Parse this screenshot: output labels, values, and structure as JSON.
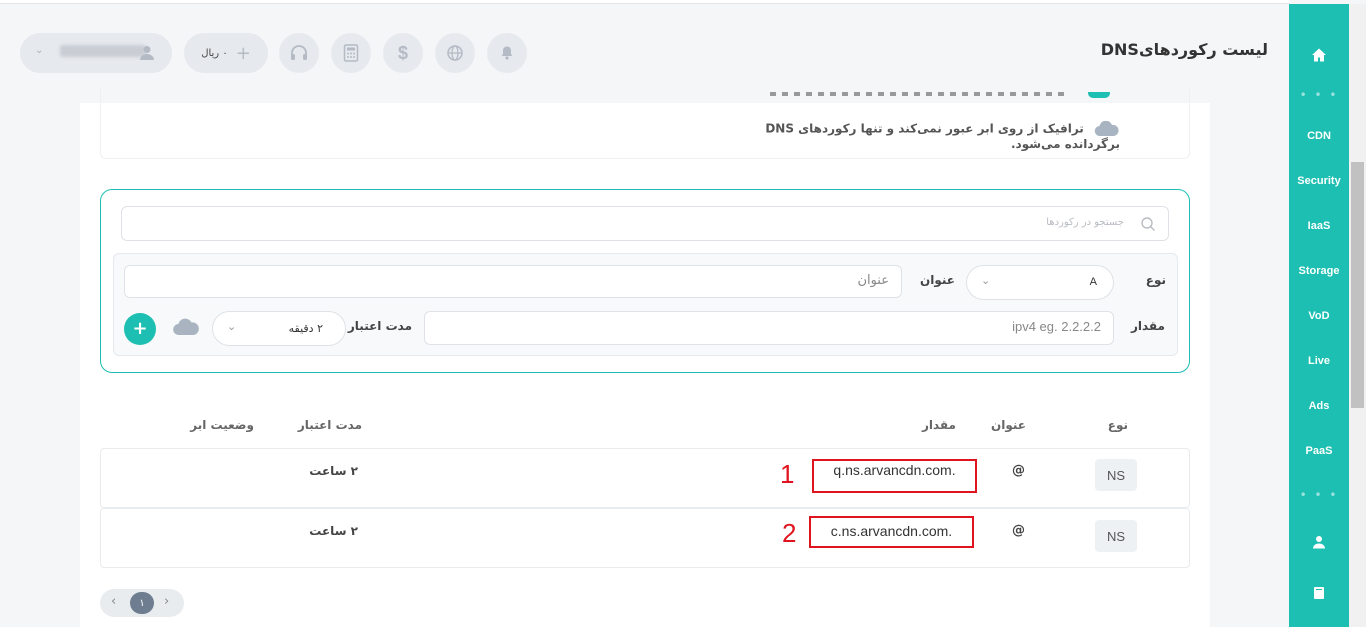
{
  "header": {
    "title": "لیست رکوردهایDNS",
    "balance": "۰ ریال",
    "user_name": "khosravian"
  },
  "sidebar": {
    "items": [
      "CDN",
      "Security",
      "IaaS",
      "Storage",
      "VoD",
      "Live",
      "Ads",
      "PaaS"
    ]
  },
  "info": {
    "cloud_off_note": "ترافیک از روی ابر عبور نمی‌کند و تنها رکوردهای DNS برگردانده می‌شود."
  },
  "filter": {
    "search_placeholder": "جستجو در رکوردها",
    "type_label": "نوع",
    "type_value": "A",
    "name_label": "عنوان",
    "name_placeholder": "عنوان",
    "value_label": "مقدار",
    "value_placeholder": "ipv4 eg. 2.2.2.2",
    "ttl_label": "مدت اعتبار",
    "ttl_value": "۲ دقیقه"
  },
  "table": {
    "headers": {
      "type": "نوع",
      "name": "عنوان",
      "value": "مقدار",
      "ttl": "مدت اعتبار",
      "cloud": "وضعیت ابر"
    },
    "rows": [
      {
        "type": "NS",
        "name": "@",
        "value": "q.ns.arvancdn.com.",
        "ttl": "۲ ساعت",
        "marker": "1"
      },
      {
        "type": "NS",
        "name": "@",
        "value": "c.ns.arvancdn.com.",
        "ttl": "۲ ساعت",
        "marker": "2"
      }
    ]
  },
  "pagination": {
    "current": "۱"
  },
  "colors": {
    "accent": "#1dbfb2",
    "annotation": "#e0141e"
  }
}
